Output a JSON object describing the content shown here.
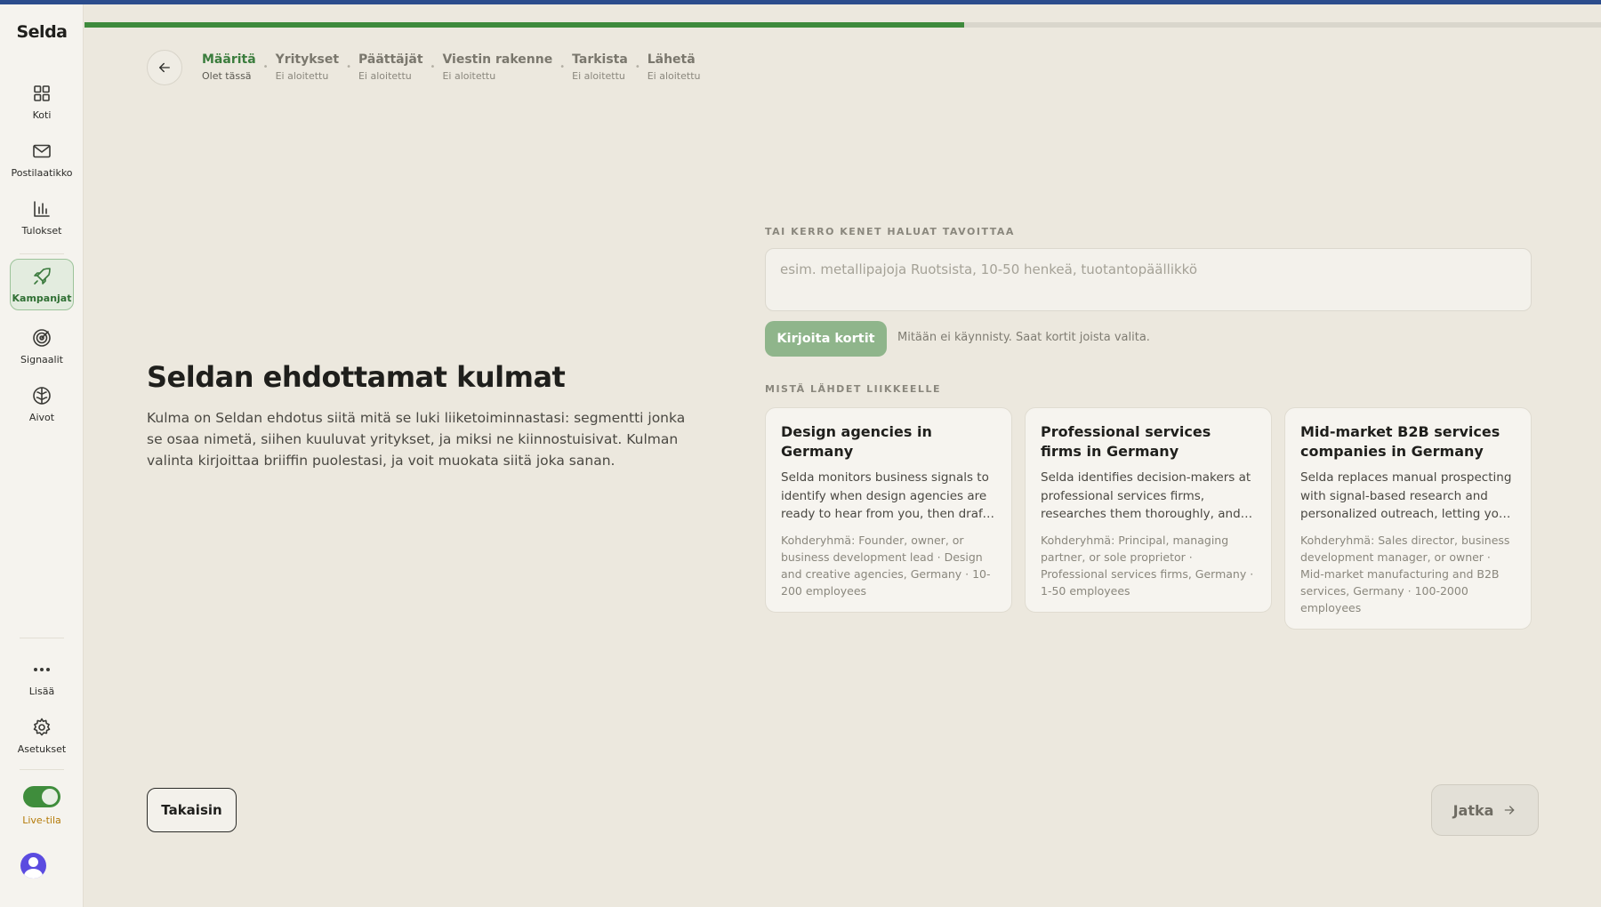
{
  "app": {
    "name": "Selda"
  },
  "sidebar": {
    "items": [
      {
        "label": "Koti",
        "icon": "grid-icon"
      },
      {
        "label": "Postilaatikko",
        "icon": "mail-icon"
      },
      {
        "label": "Tulokset",
        "icon": "bar-chart-icon"
      },
      {
        "label": "Kampanjat",
        "icon": "rocket-icon",
        "active": true
      },
      {
        "label": "Signaalit",
        "icon": "radar-icon"
      },
      {
        "label": "Aivot",
        "icon": "brain-icon"
      }
    ],
    "more_label": "Lisää",
    "settings_label": "Asetukset",
    "live_label": "Live-tila",
    "live_on": true
  },
  "progress": {
    "fraction": 0.58,
    "color": "#3e8a3c"
  },
  "steps": [
    {
      "title": "Määritä",
      "status": "Olet tässä",
      "current": true
    },
    {
      "title": "Yritykset",
      "status": "Ei aloitettu"
    },
    {
      "title": "Päättäjät",
      "status": "Ei aloitettu"
    },
    {
      "title": "Viestin rakenne",
      "status": "Ei aloitettu"
    },
    {
      "title": "Tarkista",
      "status": "Ei aloitettu"
    },
    {
      "title": "Lähetä",
      "status": "Ei aloitettu"
    }
  ],
  "main": {
    "heading": "Seldan ehdottamat kulmat",
    "lead": "Kulma on Seldan ehdotus siitä mitä se luki liiketoiminnastasi: segmentti jonka se osaa nimetä, siihen kuuluvat yritykset, ja miksi ne kiinnostuisivat. Kulman valinta kirjoittaa briiffin puolestasi, ja voit muokata siitä joka sanan."
  },
  "form": {
    "section_label": "TAI KERRO KENET HALUAT TAVOITTAA",
    "placeholder": "esim. metallipajoja Ruotsista, 10-50 henkeä, tuotantopäällikkö",
    "value": "",
    "write_button": "Kirjoita kortit",
    "hint": "Mitään ei käynnisty. Saat kortit joista valita."
  },
  "cards_section_label": "MISTÄ LÄHDET LIIKKEELLE",
  "cards": [
    {
      "title": "Design agencies in Germany",
      "description": "Selda monitors business signals to identify when design agencies are ready to hear from you, then drafts personalized outreach.",
      "meta": "Kohderyhmä: Founder, owner, or business development lead · Design and creative agencies, Germany · 10-200 employees"
    },
    {
      "title": "Professional services firms in Germany",
      "description": "Selda identifies decision-makers at professional services firms, researches them thoroughly, and writes outreach for each.",
      "meta": "Kohderyhmä: Principal, managing partner, or sole proprietor · Professional services firms, Germany · 1-50 employees"
    },
    {
      "title": "Mid-market B2B services companies in Germany",
      "description": "Selda replaces manual prospecting with signal-based research and personalized outreach, letting your team focus on conversations.",
      "meta": "Kohderyhmä: Sales director, business development manager, or owner · Mid-market manufacturing and B2B services, Germany · 100-2000 employees"
    }
  ],
  "footer": {
    "back_label": "Takaisin",
    "next_label": "Jatka"
  }
}
